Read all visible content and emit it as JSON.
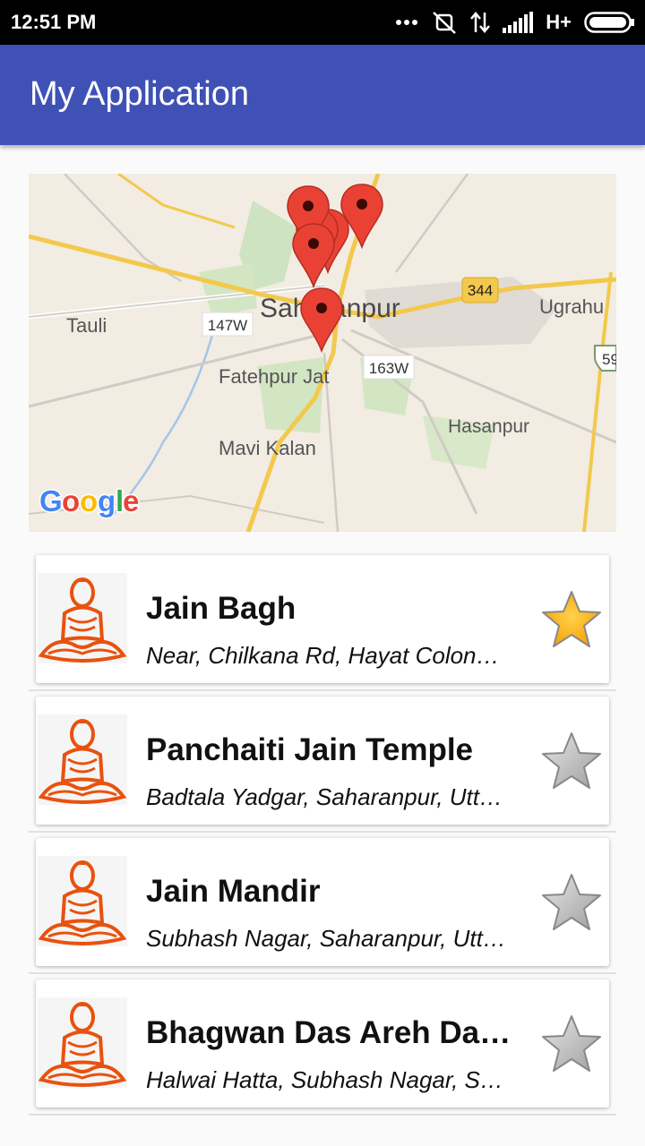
{
  "status_bar": {
    "time": "12:51 PM",
    "network": "H+",
    "icons": [
      "more-dots-icon",
      "mute-icon",
      "data-arrows-icon",
      "signal-icon",
      "network-type",
      "battery-icon"
    ]
  },
  "app_bar": {
    "title": "My Application"
  },
  "map": {
    "labels": {
      "saharanpur": "Saharanpur",
      "tauli": "Tauli",
      "fatehpur_jat": "Fatehpur Jat",
      "mavi_kalan": "Mavi Kalan",
      "hasanpur": "Hasanpur",
      "ugrahu": "Ugrahu",
      "road_147w": "147W",
      "road_163w": "163W",
      "road_344": "344",
      "road_59": "59"
    },
    "google_logo": {
      "G": "G",
      "o1": "o",
      "o2": "o",
      "g": "g",
      "l": "l",
      "e": "e"
    },
    "marker_color": "#e94235"
  },
  "places": [
    {
      "name": "Jain Bagh",
      "address": "Near, Chilkana Rd, Hayat Colony, Saharanpur",
      "favorite": true
    },
    {
      "name": "Panchaiti Jain Temple",
      "address": "Badtala Yadgar, Saharanpur, Uttar Pradesh",
      "favorite": false
    },
    {
      "name": "Jain Mandir",
      "address": "Subhash Nagar, Saharanpur, Uttar Pradesh",
      "favorite": false
    },
    {
      "name": "Bhagwan Das Areh Das Jain Temple",
      "address": "Halwai Hatta, Subhash Nagar, Saharanpur",
      "favorite": false
    }
  ],
  "colors": {
    "app_bar": "#3f51b5",
    "thumb_orange": "#e8520e",
    "star_gold": "#f7a30b",
    "star_grey": "#bdbdbd"
  }
}
